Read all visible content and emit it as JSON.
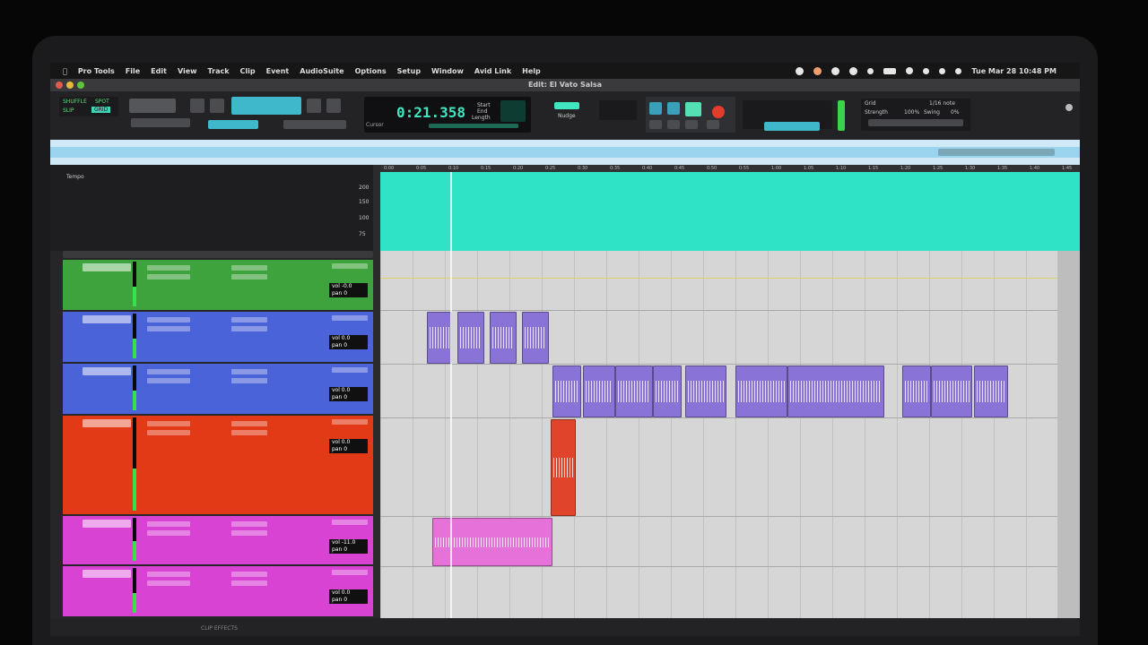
{
  "menubar": {
    "items": [
      "Pro Tools",
      "File",
      "Edit",
      "View",
      "Track",
      "Clip",
      "Event",
      "AudioSuite",
      "Options",
      "Setup",
      "Window",
      "Avid Link",
      "Help"
    ],
    "clock": "Tue Mar 28  10:48 PM"
  },
  "window": {
    "title": "Edit: El Vato Salsa"
  },
  "toolbar": {
    "edit_modes": [
      "SHUFFLE",
      "SPOT",
      "SLIP",
      "GRID"
    ],
    "counter": "0:21.358",
    "counter_labels": [
      "Start",
      "End",
      "Length"
    ],
    "cursor_label": "Cursor",
    "nudge_label": "Nudge",
    "grid_label": "Grid",
    "strength_label": "Strength",
    "strength_value": "100%",
    "swing_label": "Swing",
    "swing_value": "0%",
    "grid_value": "1/16 note"
  },
  "tempo_ruler": {
    "label": "Tempo",
    "values": [
      "200",
      "150",
      "100",
      "75"
    ]
  },
  "ruler_ticks": [
    "0:00",
    "0:05",
    "0:10",
    "0:15",
    "0:20",
    "0:25",
    "0:30",
    "0:35",
    "0:40",
    "0:45",
    "0:50",
    "0:55",
    "1:00",
    "1:05",
    "1:10",
    "1:15",
    "1:20",
    "1:25",
    "1:30",
    "1:35",
    "1:40",
    "1:45"
  ],
  "tracks": [
    {
      "color": "#3fa33d",
      "vol": "vol -0.0",
      "pan": "pan  0"
    },
    {
      "color": "#4a63d9",
      "vol": "vol 0.0",
      "pan": "pan  0"
    },
    {
      "color": "#4a63d9",
      "vol": "vol 0.0",
      "pan": "pan  0"
    },
    {
      "color": "#e23a17",
      "vol": "vol 0.0",
      "pan": "pan  0"
    },
    {
      "color": "#d843d4",
      "vol": "vol -11.0",
      "pan": "pan  0"
    },
    {
      "color": "#d843d4",
      "vol": "vol 0.0",
      "pan": "pan  0"
    }
  ],
  "bottom": {
    "label": "CLIP EFFECTS"
  },
  "colors": {
    "tempo": "#2ee3c6",
    "edit_bg": "#d6d6d6",
    "counter": "#41e6c0",
    "record": "#e53b2b"
  }
}
